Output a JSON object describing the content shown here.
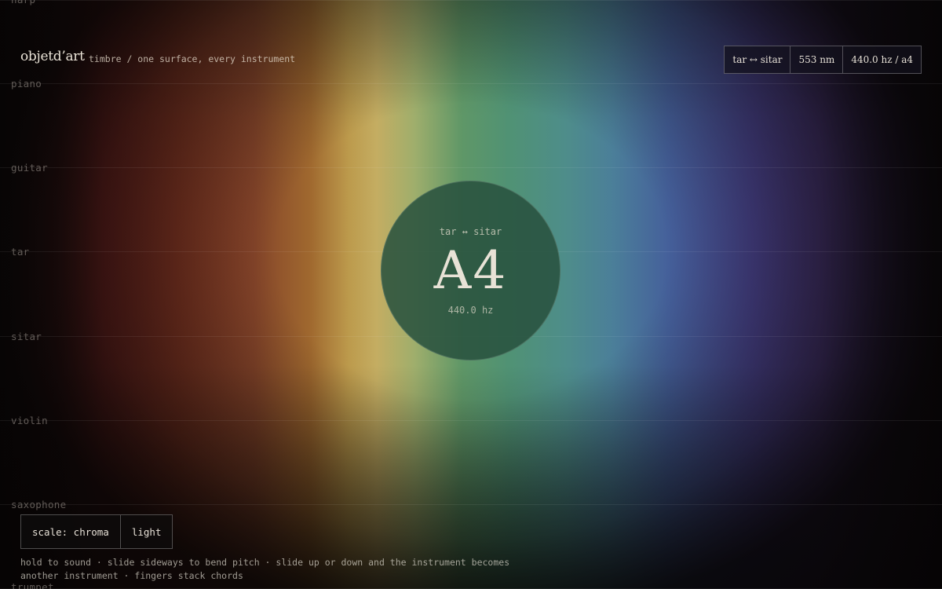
{
  "header": {
    "brand": "objetd’art",
    "tagline": "timbre / one surface, every instrument"
  },
  "status": {
    "instrument": "tar ↔ sitar",
    "wavelength": "553 nm",
    "frequency": "440.0 hz / a4"
  },
  "lanes": [
    {
      "label": "harp"
    },
    {
      "label": "piano"
    },
    {
      "label": "guitar"
    },
    {
      "label": "tar"
    },
    {
      "label": "sitar"
    },
    {
      "label": "violin"
    },
    {
      "label": "saxophone"
    },
    {
      "label": "trumpet"
    }
  ],
  "note": {
    "instrument": "tar ↔ sitar",
    "name": "A4",
    "frequency": "440.0 hz"
  },
  "controls": {
    "scale": "scale: chroma",
    "theme": "light"
  },
  "instructions": {
    "line1": "hold to sound · slide sideways to bend pitch · slide up or down and the instrument becomes",
    "line2": "another instrument · fingers stack chords"
  },
  "colors": {
    "red": "#5a1d1a",
    "orange": "#86452a",
    "yellow": "#c4ad62",
    "green": "#5f9767",
    "teal": "#4e8d8a",
    "blue": "#45609b",
    "violet": "#453f85",
    "circle": "#28503e",
    "text": "#e8e2d6"
  }
}
